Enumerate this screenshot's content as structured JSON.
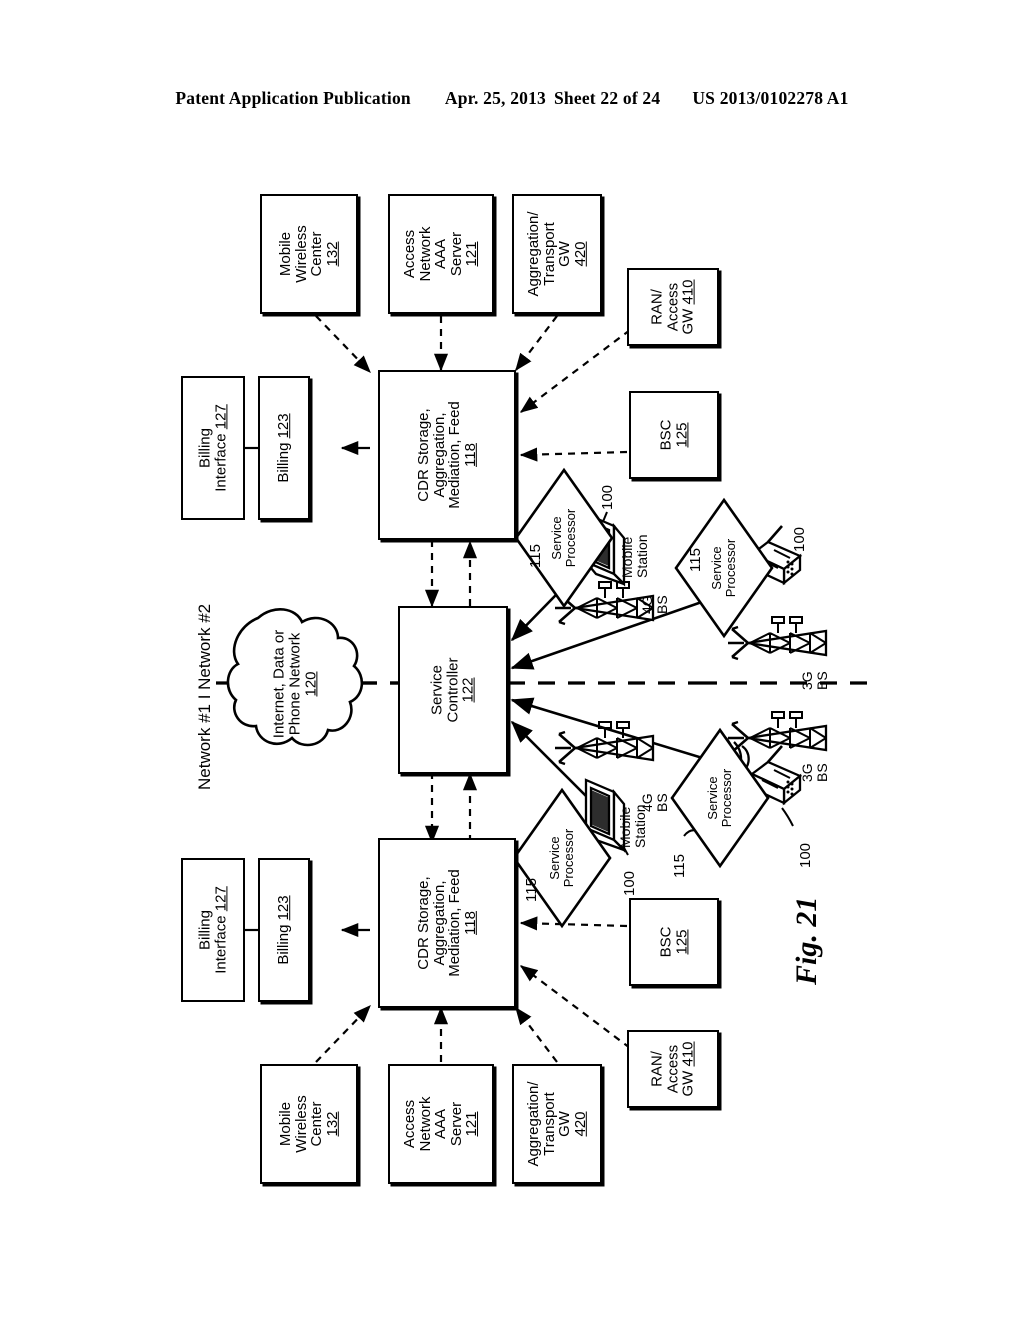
{
  "header": {
    "publication": "Patent Application Publication",
    "date": "Apr. 25, 2013",
    "sheet": "Sheet 22 of 24",
    "doc_number": "US 2013/0102278 A1"
  },
  "figure": {
    "caption": "Fig. 21",
    "network_divider_label": "Network #1  I  Network #2",
    "network_label_left": "Network #1",
    "network_label_right": "Network #2"
  },
  "cloud": {
    "line1": "Internet, Data or",
    "line2": "Phone Network",
    "num": "120"
  },
  "top": {
    "mobile_wireless_center": {
      "line1": "Mobile",
      "line2": "Wireless",
      "line3": "Center",
      "num": "132"
    },
    "access_network_aaa": {
      "line1": "Access",
      "line2": "Network",
      "line3": "AAA",
      "line4": "Server",
      "num": "121"
    },
    "aggregation_transport_gw": {
      "line1": "Aggregation/",
      "line2": "Transport",
      "line3": "GW",
      "num": "420"
    },
    "ran_access_gw": {
      "line1": "RAN/",
      "line2": "Access",
      "line3": "GW ",
      "num": "410"
    },
    "bsc": {
      "line1": "BSC",
      "num": "125"
    },
    "cdr": {
      "line1": "CDR Storage,",
      "line2": "Aggregation,",
      "line3": "Mediation, Feed",
      "num": "118"
    },
    "billing_interface": {
      "line1": "Billing",
      "line2": "Interface ",
      "num": "127"
    },
    "billing": {
      "line1": "Billing ",
      "num": "123"
    },
    "service_processor_a": {
      "line1": "Service",
      "line2": "Processor"
    },
    "service_processor_b": {
      "line1": "Service",
      "line2": "Processor"
    },
    "mobile_station": {
      "line1": "Mobile",
      "line2": "Station"
    },
    "bs_4g": {
      "line1": "4G",
      "line2": "BS"
    },
    "bs_3g": {
      "line1": "3G",
      "line2": "BS"
    },
    "ref_115_a": "115",
    "ref_115_b": "115",
    "ref_100_a": "100",
    "ref_100_b": "100"
  },
  "center": {
    "service_controller": {
      "line1": "Service",
      "line2": "Controller",
      "num": "122"
    }
  },
  "bottom": {
    "mobile_wireless_center": {
      "line1": "Mobile",
      "line2": "Wireless",
      "line3": "Center",
      "num": "132"
    },
    "access_network_aaa": {
      "line1": "Access",
      "line2": "Network",
      "line3": "AAA",
      "line4": "Server",
      "num": "121"
    },
    "aggregation_transport_gw": {
      "line1": "Aggregation/",
      "line2": "Transport",
      "line3": "GW",
      "num": "420"
    },
    "ran_access_gw": {
      "line1": "RAN/",
      "line2": "Access",
      "line3": "GW ",
      "num": "410"
    },
    "bsc": {
      "line1": "BSC",
      "num": "125"
    },
    "cdr": {
      "line1": "CDR Storage,",
      "line2": "Aggregation,",
      "line3": "Mediation, Feed",
      "num": "118"
    },
    "billing_interface": {
      "line1": "Billing",
      "line2": "Interface ",
      "num": "127"
    },
    "billing": {
      "line1": "Billing ",
      "num": "123"
    },
    "service_processor_a": {
      "line1": "Service",
      "line2": "Processor"
    },
    "service_processor_b": {
      "line1": "Service",
      "line2": "Processor"
    },
    "mobile_station": {
      "line1": "Mobile",
      "line2": "Station"
    },
    "bs_4g": {
      "line1": "4G",
      "line2": "BS"
    },
    "bs_3g": {
      "line1": "3G",
      "line2": "BS"
    },
    "ref_115_a": "115",
    "ref_115_b": "115",
    "ref_100_a": "100",
    "ref_100_b": "100"
  }
}
